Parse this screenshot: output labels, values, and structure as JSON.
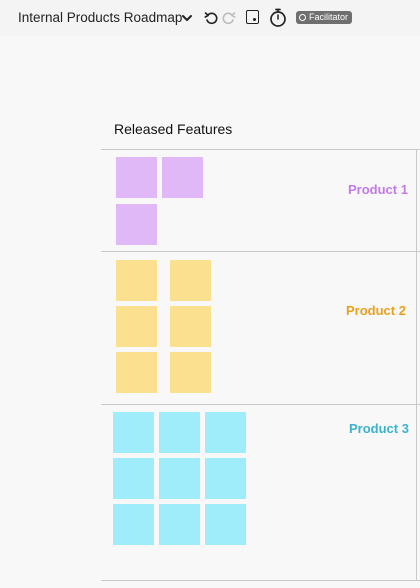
{
  "toolbar": {
    "title": "Internal Products Roadmap",
    "icons": [
      "chevron-down-icon",
      "undo-icon",
      "redo-icon",
      "frame-icon",
      "timer-icon"
    ],
    "facilitator_badge": "Facilitator"
  },
  "board": {
    "section_title": "Released Features",
    "rows": [
      {
        "label": "Product 1",
        "color": "#c27be6",
        "sticky_color": "#e0b8f7",
        "sticky_count": 3
      },
      {
        "label": "Product 2",
        "color": "#e8a11d",
        "sticky_color": "#fbe08f",
        "sticky_count": 6
      },
      {
        "label": "Product 3",
        "color": "#3ab3cf",
        "sticky_color": "#9fecfb",
        "sticky_count": 9
      }
    ]
  }
}
